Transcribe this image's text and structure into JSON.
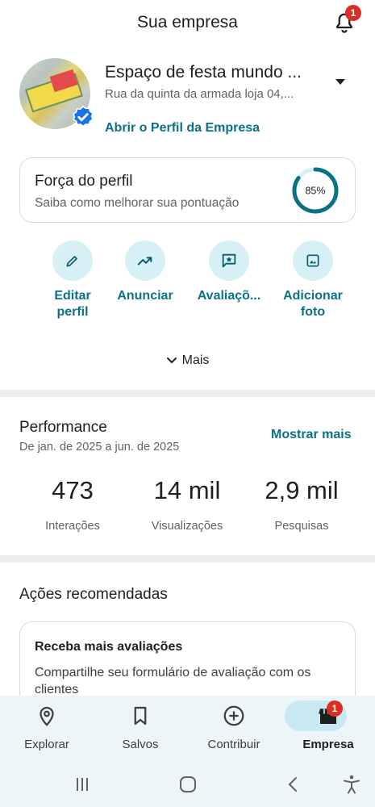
{
  "header": {
    "title": "Sua empresa",
    "notification_count": "1"
  },
  "profile": {
    "name": "Espaço de festa mundo ...",
    "address": "Rua da quinta da armada loja 04,...",
    "open_profile_label": "Abrir o Perfil da Empresa"
  },
  "profile_strength": {
    "title": "Força do perfil",
    "subtitle": "Saiba como melhorar sua pontuação",
    "percent_label": "85%",
    "percent": 85,
    "ring_color": "#0b7285"
  },
  "actions": [
    {
      "label_line1": "Editar",
      "label_line2": "perfil",
      "icon": "pencil-icon"
    },
    {
      "label_line1": "Anunciar",
      "label_line2": "",
      "icon": "trending-up-icon"
    },
    {
      "label_line1": "Avaliaçõ...",
      "label_line2": "",
      "icon": "review-star-icon"
    },
    {
      "label_line1": "Adicionar",
      "label_line2": "foto",
      "icon": "add-photo-icon"
    }
  ],
  "more_label": "Mais",
  "performance": {
    "title": "Performance",
    "range": "De jan. de 2025 a jun. de 2025",
    "show_more_label": "Mostrar mais",
    "stats": [
      {
        "value": "473",
        "label": "Interações"
      },
      {
        "value": "14 mil",
        "label": "Visualizações"
      },
      {
        "value": "2,9 mil",
        "label": "Pesquisas"
      }
    ]
  },
  "recommended": {
    "title": "Ações recomendadas",
    "card_title": "Receba mais avaliações",
    "card_description": "Compartilhe seu formulário de avaliação com os clientes"
  },
  "bottom_nav": {
    "items": [
      {
        "label": "Explorar",
        "icon": "location-pin-icon"
      },
      {
        "label": "Salvos",
        "icon": "bookmark-icon"
      },
      {
        "label": "Contribuir",
        "icon": "add-circle-icon"
      },
      {
        "label": "Empresa",
        "icon": "storefront-icon"
      }
    ],
    "active_index": 3,
    "empresa_badge": "1"
  },
  "colors": {
    "accent": "#0b7285",
    "action_bg": "#d6f0f5",
    "badge": "#d93025",
    "nav_bg": "#edf5f8"
  }
}
